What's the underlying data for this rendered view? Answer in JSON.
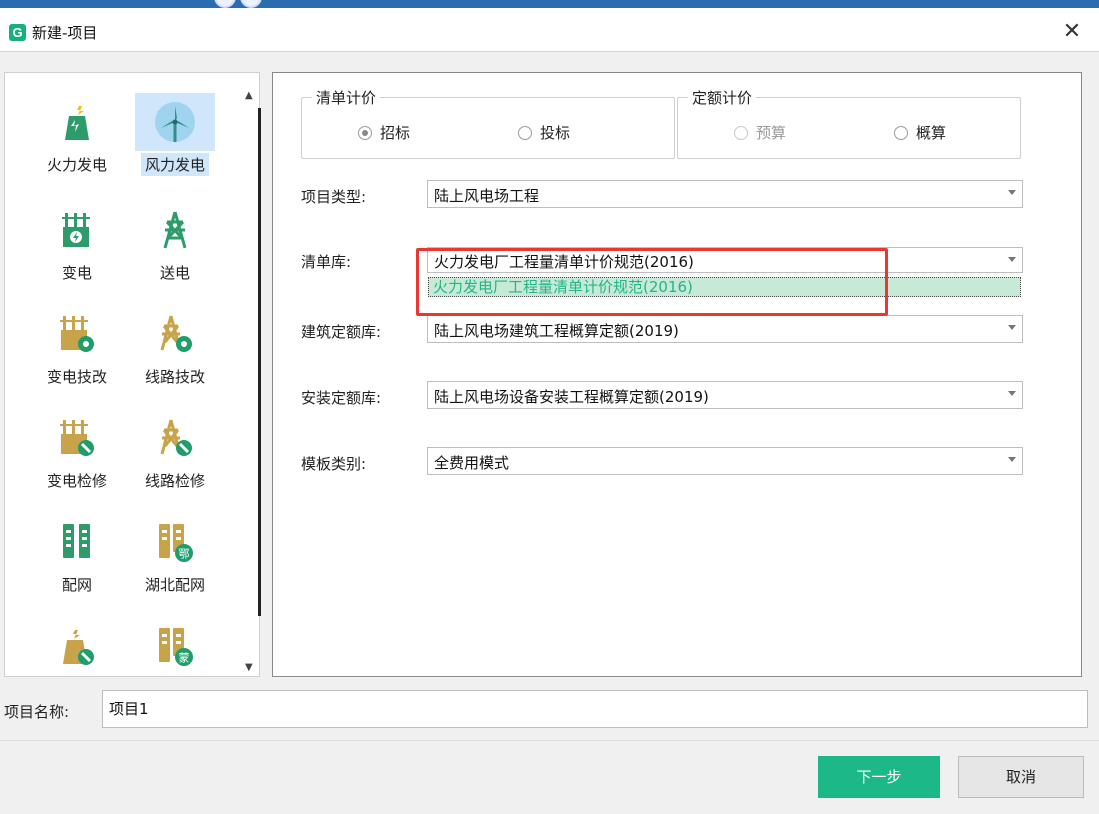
{
  "window": {
    "title": "新建-项目",
    "logo_text": "G",
    "close_symbol": "✕"
  },
  "categories": [
    {
      "label": "火力发电",
      "icon": "thermal-power-icon"
    },
    {
      "label": "风力发电",
      "icon": "wind-turbine-icon",
      "selected": true
    },
    {
      "label": "变电",
      "icon": "substation-icon"
    },
    {
      "label": "送电",
      "icon": "transmission-tower-icon"
    },
    {
      "label": "变电技改",
      "icon": "substation-upgrade-icon"
    },
    {
      "label": "线路技改",
      "icon": "line-upgrade-icon"
    },
    {
      "label": "变电检修",
      "icon": "substation-repair-icon"
    },
    {
      "label": "线路检修",
      "icon": "line-repair-icon"
    },
    {
      "label": "配网",
      "icon": "distribution-network-icon"
    },
    {
      "label": "湖北配网",
      "icon": "hubei-distribution-icon"
    },
    {
      "label": "",
      "icon": "thermal-repair-icon"
    },
    {
      "label": "",
      "icon": "inner-mongolia-distribution-icon"
    }
  ],
  "category_badges": {
    "hubei": "鄂",
    "mongolia": "蒙"
  },
  "billing": {
    "legend": "清单计价",
    "options": [
      {
        "label": "招标",
        "selected": true
      },
      {
        "label": "投标",
        "selected": false
      }
    ]
  },
  "quota": {
    "legend": "定额计价",
    "options": [
      {
        "label": "预算",
        "disabled": true
      },
      {
        "label": "概算",
        "selected": false
      }
    ]
  },
  "fields": {
    "project_type": {
      "label": "项目类型:",
      "value": "陆上风电场工程"
    },
    "bill_library": {
      "label": "清单库:",
      "value": "火力发电厂工程量清单计价规范(2016)"
    },
    "bill_library_dropdown_item": "火力发电厂工程量清单计价规范(2016)",
    "building_quota": {
      "label": "建筑定额库:",
      "value": "陆上风电场建筑工程概算定额(2019)"
    },
    "install_quota": {
      "label": "安装定额库:",
      "value": "陆上风电场设备安装工程概算定额(2019)"
    },
    "template_type": {
      "label": "模板类别:",
      "value": "全费用模式"
    }
  },
  "project_name": {
    "label": "项目名称:",
    "value": "项目1"
  },
  "buttons": {
    "next": "下一步",
    "cancel": "取消"
  },
  "colors": {
    "accent": "#1cb888",
    "highlight": "#e8382f",
    "selected_bg": "#cfe6fb"
  }
}
